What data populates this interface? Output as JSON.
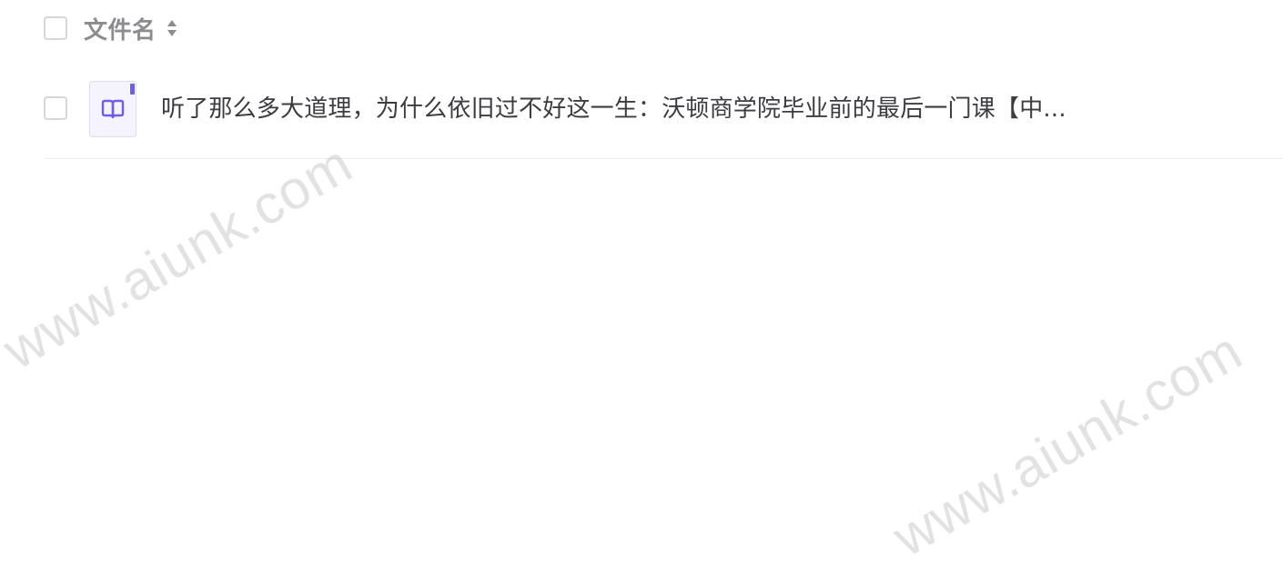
{
  "header": {
    "column_label": "文件名",
    "sort_icon": "sort-up-down-icon"
  },
  "files": [
    {
      "name": "听了那么多大道理，为什么依旧过不好这一生：沃顿商学院毕业前的最后一门课【中...",
      "icon": "open-book-icon",
      "selected": false
    }
  ],
  "watermark": {
    "text": "www.aiunk.com"
  },
  "colors": {
    "accent": "#6c5ee8",
    "thumb_bg": "#f4f3fe",
    "header_text": "#8b8b90",
    "body_text": "#3c3c42",
    "divider": "#ededf0"
  }
}
